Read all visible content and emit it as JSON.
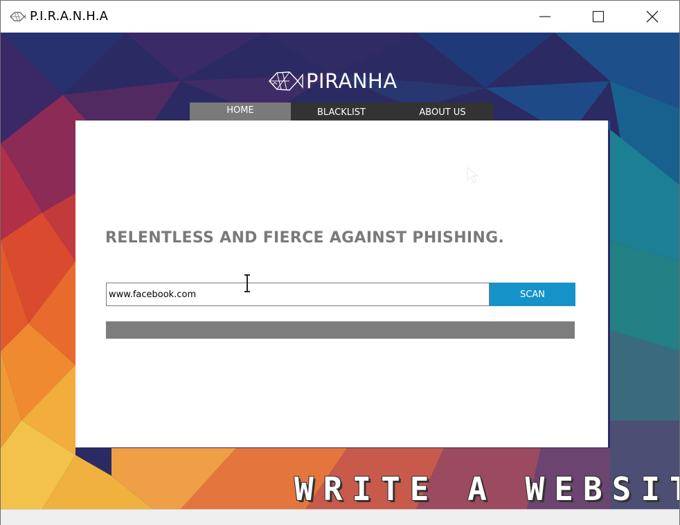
{
  "window": {
    "title": "P.I.R.A.N.H.A"
  },
  "header": {
    "logo_text": "PIRANHA"
  },
  "nav": {
    "tabs": [
      {
        "label": "HOME",
        "active": true
      },
      {
        "label": "BLACKLIST",
        "active": false
      },
      {
        "label": "ABOUT US",
        "active": false
      }
    ]
  },
  "main": {
    "headline": "RELENTLESS AND FIERCE AGAINST PHISHING.",
    "url_value": "www.facebook.com",
    "scan_label": "SCAN",
    "progress_fraction": 1.0
  },
  "overlay": {
    "text": "WRITE A WEBSITE"
  },
  "colors": {
    "scan_button": "#1593c9",
    "progress_fill": "#7d7d7d",
    "headline": "#7a7a7a",
    "active_tab": "#7a7a7a",
    "nav_bar": "#333333"
  },
  "icons": {
    "app": "piranha-fish-icon",
    "minimize": "minimize-icon",
    "maximize": "maximize-icon",
    "close": "close-icon"
  }
}
